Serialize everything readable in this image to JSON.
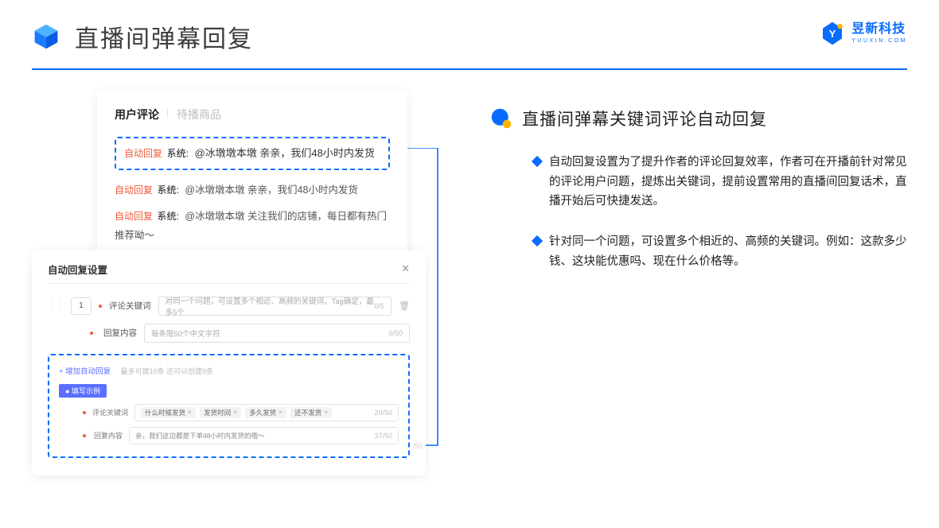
{
  "header": {
    "title": "直播间弹幕回复"
  },
  "brand": {
    "cn": "昱新科技",
    "en": "YUUXIN.COM"
  },
  "panelTop": {
    "tabs": {
      "active": "用户评论",
      "inactive": "待播商品"
    },
    "highlighted": {
      "tag": "自动回复",
      "sys": "系统:",
      "text": "@冰墩墩本墩 亲亲，我们48小时内发货"
    },
    "line2": {
      "tag": "自动回复",
      "sys": "系统:",
      "text": "@冰墩墩本墩 亲亲，我们48小时内发货"
    },
    "line3": {
      "tag": "自动回复",
      "sys": "系统:",
      "text": "@冰墩墩本墩 关注我们的店铺，每日都有热门推荐呦～"
    }
  },
  "panelBottom": {
    "title": "自动回复设置",
    "index": "1",
    "keywordLabel": "评论关键词",
    "keywordPlaceholder": "对同一个问题，可设置多个相近、高频的关键词，Tag确定，最多5个",
    "keywordCount": "0/5",
    "contentLabel": "回复内容",
    "contentPlaceholder": "每条限50个中文字符",
    "contentCount": "0/50",
    "addLink": "+ 增加自动回复",
    "addHint": "最多可建10条 还可以创建9条",
    "badge": "● 填写示例",
    "exKeywordLabel": "评论关键词",
    "exTags": [
      "什么时候发货",
      "发货时间",
      "多久发货",
      "还不发货"
    ],
    "exKeywordCount": "20/50",
    "exContentLabel": "回复内容",
    "exContentText": "亲，我们这边都是下单48小时内发货的哦～",
    "exContentCount": "37/50",
    "ghostCount": "/50"
  },
  "right": {
    "title": "直播间弹幕关键词评论自动回复",
    "b1": "自动回复设置为了提升作者的评论回复效率，作者可在开播前针对常见的评论用户问题，提炼出关键词，提前设置常用的直播间回复话术，直播开始后可快捷发送。",
    "b2": "针对同一个问题，可设置多个相近的、高频的关键词。例如：这款多少钱、这块能优惠吗、现在什么价格等。"
  }
}
